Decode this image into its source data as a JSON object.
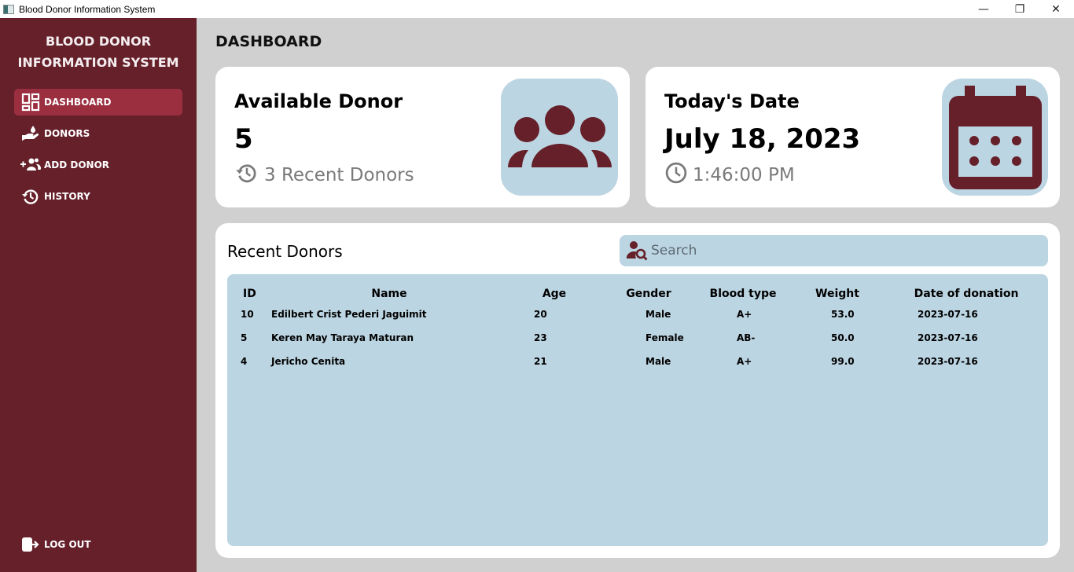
{
  "window": {
    "title": "Blood Donor Information System",
    "controls": {
      "minimize": "—",
      "restore": "❐",
      "close": "✕"
    }
  },
  "sidebar": {
    "brand_line1": "BLOOD DONOR",
    "brand_line2": "INFORMATION SYSTEM",
    "items": [
      {
        "label": "DASHBOARD",
        "icon": "dashboard-icon",
        "active": true
      },
      {
        "label": "DONORS",
        "icon": "donate-hand-icon",
        "active": false
      },
      {
        "label": "ADD DONOR",
        "icon": "add-user-group-icon",
        "active": false
      },
      {
        "label": "HISTORY",
        "icon": "history-icon",
        "active": false
      }
    ],
    "logout_label": "LOG OUT"
  },
  "main": {
    "title": "DASHBOARD",
    "cards": {
      "available": {
        "label": "Available Donor",
        "value": "5",
        "sub": "3 Recent Donors"
      },
      "date": {
        "label": "Today's Date",
        "value": "July 18, 2023",
        "sub": "1:46:00 PM"
      }
    },
    "recent": {
      "title": "Recent Donors",
      "search_placeholder": "Search",
      "columns": [
        "ID",
        "Name",
        "Age",
        "Gender",
        "Blood type",
        "Weight",
        "Date of donation"
      ],
      "rows": [
        [
          "10",
          "Edilbert Crist Pederi Jaguimit",
          "20",
          "Male",
          "A+",
          "53.0",
          "2023-07-16"
        ],
        [
          "5",
          "Keren May Taraya Maturan",
          "23",
          "Female",
          "AB-",
          "50.0",
          "2023-07-16"
        ],
        [
          "4",
          "Jericho  Cenita",
          "21",
          "Male",
          "A+",
          "99.0",
          "2023-07-16"
        ]
      ]
    }
  },
  "colors": {
    "sidebar": "#65202a",
    "active": "#9b2f40",
    "tile": "#bcd5e2",
    "icon": "#65202a"
  }
}
